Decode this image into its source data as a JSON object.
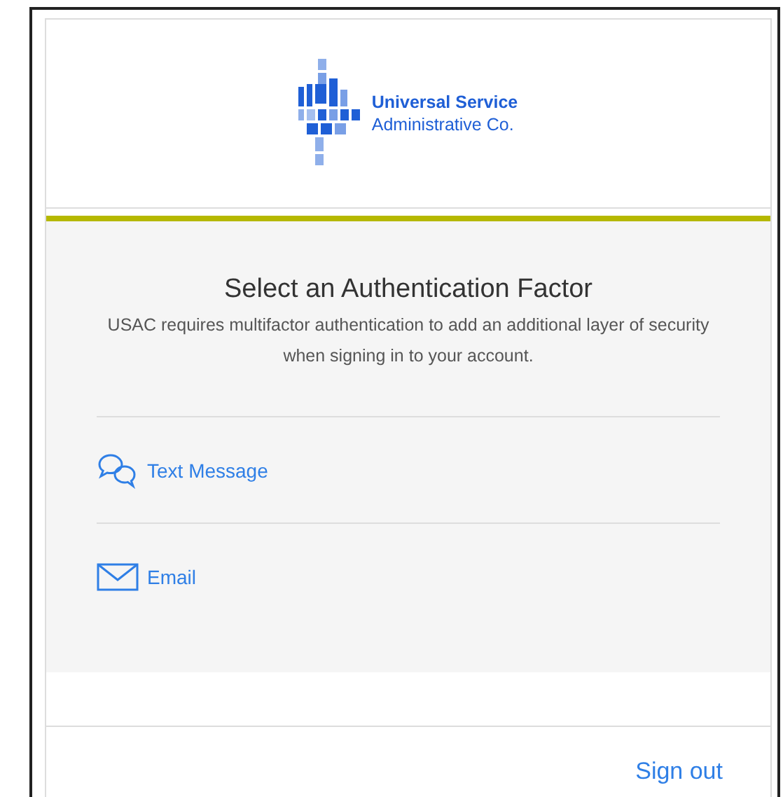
{
  "logo": {
    "line1": "Universal Service",
    "line2": "Administrative Co."
  },
  "heading": "Select an Authentication Factor",
  "description": "USAC requires multifactor authentication to add an additional layer of security when signing in to your account.",
  "factors": [
    {
      "kind": "sms",
      "label": "Text Message"
    },
    {
      "kind": "email",
      "label": "Email"
    }
  ],
  "sign_out": "Sign out"
}
